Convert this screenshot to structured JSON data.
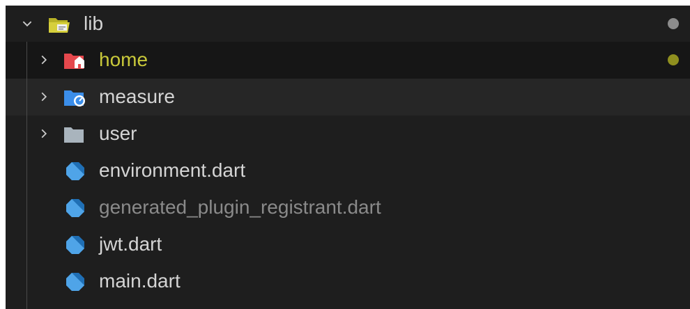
{
  "explorer": {
    "root": {
      "label": "lib",
      "expanded": true,
      "icon": "folder-open-icon",
      "decoration_color": "#8c8c8c"
    },
    "items": [
      {
        "label": "home",
        "type": "folder",
        "icon": "folder-home-icon",
        "color": "#e5484d",
        "label_color": "#c9c93a",
        "decoration_color": "#8f8f1f"
      },
      {
        "label": "measure",
        "type": "folder",
        "icon": "folder-measure-icon",
        "color": "#3b8eea"
      },
      {
        "label": "user",
        "type": "folder",
        "icon": "folder-icon",
        "color": "#a9b4bd"
      },
      {
        "label": "environment.dart",
        "type": "file",
        "icon": "dart-icon",
        "color": "#4fa4e8"
      },
      {
        "label": "generated_plugin_registrant.dart",
        "type": "file",
        "icon": "dart-icon",
        "color": "#4fa4e8",
        "dimmed": true
      },
      {
        "label": "jwt.dart",
        "type": "file",
        "icon": "dart-icon",
        "color": "#4fa4e8"
      },
      {
        "label": "main.dart",
        "type": "file",
        "icon": "dart-icon",
        "color": "#4fa4e8"
      }
    ]
  }
}
